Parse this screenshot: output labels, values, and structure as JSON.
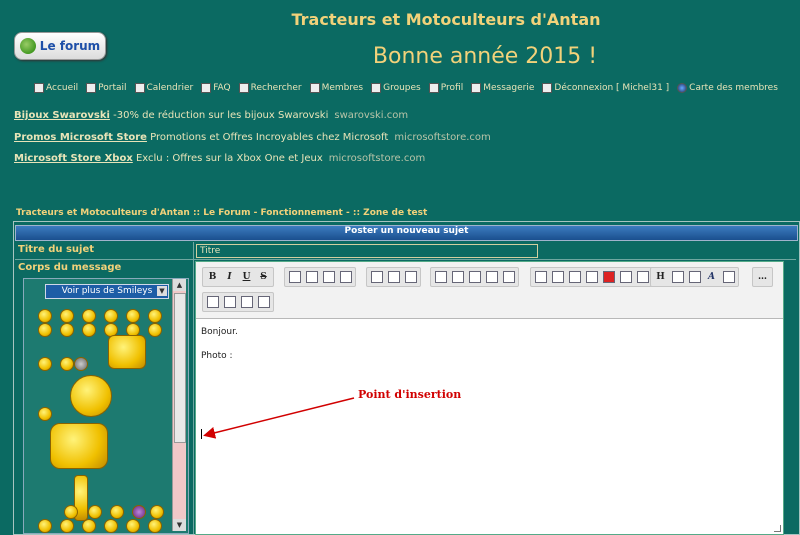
{
  "header": {
    "site_title": "Tracteurs et Motoculteurs d'Antan",
    "greeting": "Bonne année 2015 !",
    "logo_label": "Le forum"
  },
  "nav": [
    {
      "label": "Accueil",
      "icon": "home-icon"
    },
    {
      "label": "Portail",
      "icon": "portal-icon"
    },
    {
      "label": "Calendrier",
      "icon": "calendar-icon"
    },
    {
      "label": "FAQ",
      "icon": "help-icon"
    },
    {
      "label": "Rechercher",
      "icon": "search-icon"
    },
    {
      "label": "Membres",
      "icon": "members-icon"
    },
    {
      "label": "Groupes",
      "icon": "groups-icon"
    },
    {
      "label": "Profil",
      "icon": "profile-icon"
    },
    {
      "label": "Messagerie",
      "icon": "messages-icon"
    },
    {
      "label": "Déconnexion [ Michel31 ]",
      "icon": "logout-icon"
    },
    {
      "label": "Carte des membres",
      "icon": "globe-icon"
    }
  ],
  "ads": [
    {
      "link": "Bijoux Swarovski",
      "text": "-30% de réduction sur les bijoux Swarovski",
      "domain": "swarovski.com"
    },
    {
      "link": "Promos Microsoft Store",
      "text": "Promotions et Offres Incroyables chez Microsoft",
      "domain": "microsoftstore.com"
    },
    {
      "link": "Microsoft Store Xbox",
      "text": "Exclu : Offres sur la Xbox One et Jeux",
      "domain": "microsoftstore.com"
    }
  ],
  "breadcrumb": "Tracteurs et Motoculteurs d'Antan  ::  Le Forum - Fonctionnement -  :: Zone de test",
  "post": {
    "header": "Poster un nouveau sujet",
    "subject_label": "Titre du sujet",
    "subject_placeholder": "Titre",
    "body_label": "Corps du message",
    "smiley_select": "Voir plus de Smileys",
    "editor_lines": [
      "Bonjour.",
      "Photo :"
    ],
    "annotation": "Point d'insertion"
  },
  "colors": {
    "background": "#0b6a62",
    "title": "#f2d27a",
    "header_bar": "#1a4f8e",
    "annotation": "#d10000"
  }
}
